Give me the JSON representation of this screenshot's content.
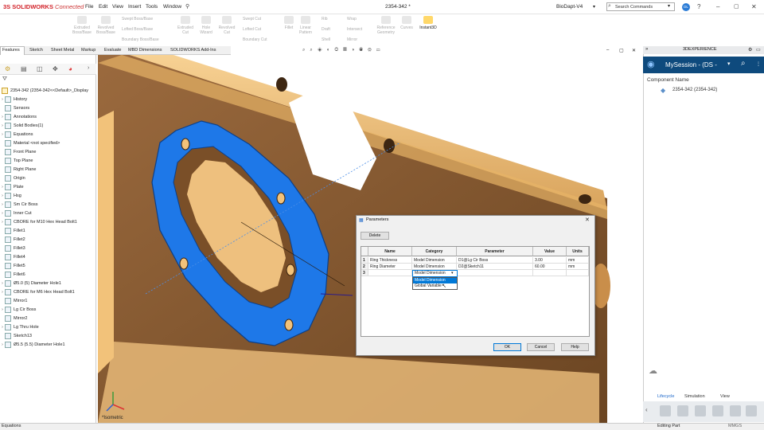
{
  "app": {
    "logo_prefix": "3S",
    "logo": "SOLIDWORKS",
    "logo_suffix": "Connected",
    "menu": [
      "File",
      "Edit",
      "View",
      "Insert",
      "Tools",
      "Window"
    ],
    "doc_title": "2354-342 *",
    "project": "BioDapt-V4",
    "search_placeholder": "Search Commands",
    "avatar": "DL"
  },
  "ribbon": {
    "large": [
      {
        "label1": "Extruded",
        "label2": "Boss/Base"
      },
      {
        "label1": "Revolved",
        "label2": "Boss/Base"
      },
      {
        "label1": "Extruded",
        "label2": "Cut"
      },
      {
        "label1": "Hole",
        "label2": "Wizard"
      },
      {
        "label1": "Revolved",
        "label2": "Cut"
      },
      {
        "label1": "Fillet",
        "label2": ""
      },
      {
        "label1": "Linear",
        "label2": "Pattern"
      },
      {
        "label1": "Reference",
        "label2": "Geometry"
      },
      {
        "label1": "Curves",
        "label2": ""
      },
      {
        "label1": "Instant3D",
        "label2": ""
      }
    ],
    "small": [
      "Swept Boss/Base",
      "Lofted Boss/Base",
      "Boundary Boss/Base",
      "Swept Cut",
      "Lofted Cut",
      "Boundary Cut",
      "Rib",
      "Draft",
      "Shell",
      "Wrap",
      "Intersect",
      "Mirror"
    ]
  },
  "tabs": [
    "Features",
    "Sketch",
    "Sheet Metal",
    "Markup",
    "Evaluate",
    "MBD Dimensions",
    "SOLIDWORKS Add-Ins"
  ],
  "tree": {
    "root": "2354-342  (2354-342<<Default>_Display",
    "items": [
      {
        "label": "History",
        "arrow": true
      },
      {
        "label": "Sensors",
        "arrow": false
      },
      {
        "label": "Annotations",
        "arrow": true
      },
      {
        "label": "Solid Bodies(1)",
        "arrow": true
      },
      {
        "label": "Equations",
        "arrow": true
      },
      {
        "label": "Material <not specified>",
        "arrow": false
      },
      {
        "label": "Front Plane",
        "arrow": false
      },
      {
        "label": "Top Plane",
        "arrow": false
      },
      {
        "label": "Right Plane",
        "arrow": false
      },
      {
        "label": "Origin",
        "arrow": false
      },
      {
        "label": "Plate",
        "arrow": true
      },
      {
        "label": "Hsg",
        "arrow": true
      },
      {
        "label": "Sm Cir Boss",
        "arrow": true
      },
      {
        "label": "Inner Cut",
        "arrow": true
      },
      {
        "label": "CBORE for M10 Hex Head Bolt1",
        "arrow": true
      },
      {
        "label": "Fillet1",
        "arrow": false
      },
      {
        "label": "Fillet2",
        "arrow": false
      },
      {
        "label": "Fillet3",
        "arrow": false
      },
      {
        "label": "Fillet4",
        "arrow": false
      },
      {
        "label": "Fillet5",
        "arrow": false
      },
      {
        "label": "Fillet6",
        "arrow": false
      },
      {
        "label": "Ø5.0 (5) Diameter Hole1",
        "arrow": true
      },
      {
        "label": "CBORE for M6 Hex Head Bolt1",
        "arrow": true
      },
      {
        "label": "Mirror1",
        "arrow": false
      },
      {
        "label": "Lg Cir Boss",
        "arrow": true
      },
      {
        "label": "Mirror2",
        "arrow": false
      },
      {
        "label": "Lg Thru Hole",
        "arrow": true
      },
      {
        "label": "Sketch13",
        "arrow": false
      },
      {
        "label": "Ø5.5 (5.5) Diameter Hole1",
        "arrow": true
      }
    ]
  },
  "viewport": {
    "view_label": "*Isometric"
  },
  "dialog": {
    "title": "Parameters",
    "delete_label": "Delete",
    "columns": [
      "",
      "Name",
      "Category",
      "Parameter",
      "Value",
      "Units"
    ],
    "rows": [
      {
        "num": "1",
        "name": "Ring Thickness",
        "category": "Model Dimension",
        "parameter": "D1@Lg Cir Boss",
        "value": "3.00",
        "units": "mm"
      },
      {
        "num": "2",
        "name": "Ring Diameter",
        "category": "Model Dimension",
        "parameter": "D2@Sketch11",
        "value": "60.00",
        "units": "mm"
      },
      {
        "num": "3",
        "name": "",
        "category": "",
        "parameter": "",
        "value": "",
        "units": ""
      }
    ],
    "dropdown_value": "Model Dimension",
    "dropdown_options": [
      "Model Dimension",
      "Global Variable"
    ],
    "ok_label": "OK",
    "cancel_label": "Cancel",
    "help_label": "Help"
  },
  "experience": {
    "header": "3DEXPERIENCE",
    "session": "MySession - (DS -",
    "component_label": "Component Name",
    "component": "2354-342 (2354-342)",
    "tabs": [
      "Lifecycle",
      "Simulation",
      "View"
    ]
  },
  "status": {
    "left": "Equations",
    "right": "Editing Part",
    "units": "MMGS"
  },
  "colors": {
    "accent": "#0e4a7d",
    "brand": "#d2232a",
    "ring": "#1e78e8",
    "part": "#f2c27a"
  }
}
